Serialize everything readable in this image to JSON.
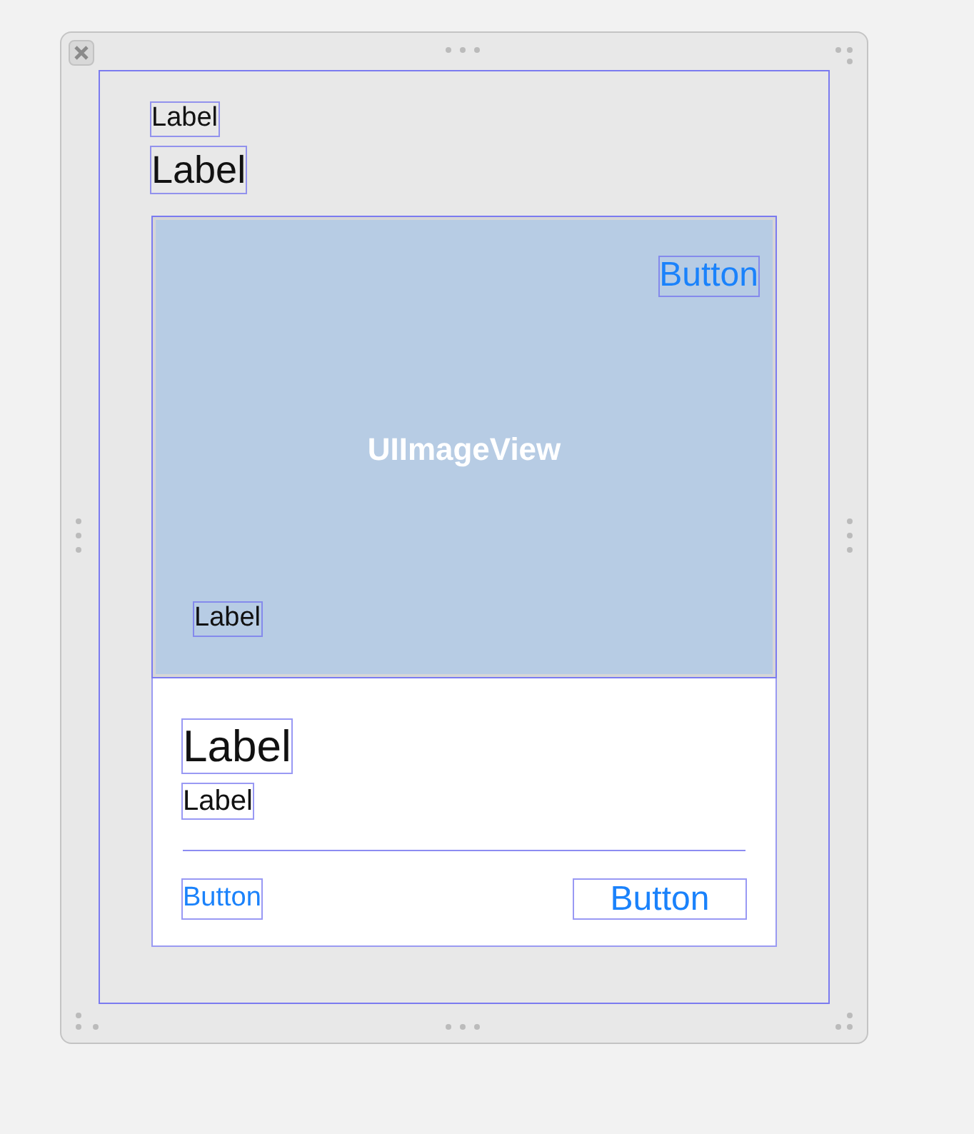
{
  "header_labels": [
    "Label",
    "Label"
  ],
  "image_view": {
    "placeholder_text": "UIImageView",
    "button": "Button",
    "caption": "Label"
  },
  "card": {
    "title": "Label",
    "subtitle": "Label",
    "buttons": [
      "Button",
      "Button"
    ]
  }
}
